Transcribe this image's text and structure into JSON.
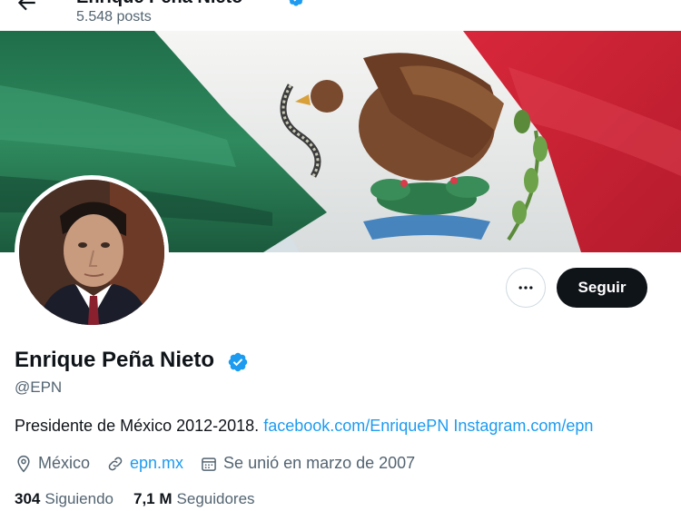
{
  "header": {
    "title": "Enrique Peña Nieto",
    "post_count": "5.548 posts"
  },
  "profile": {
    "display_name": "Enrique Peña Nieto",
    "handle": "@EPN",
    "bio_text": "Presidente de México 2012-2018.",
    "bio_link_1": "facebook.com/EnriquePN",
    "bio_link_2": "Instagram.com/epn",
    "location": "México",
    "website": "epn.mx",
    "joined": "Se unió en marzo de 2007",
    "following_count": "304",
    "following_label": "Siguiendo",
    "followers_count": "7,1 M",
    "followers_label": "Seguidores"
  },
  "actions": {
    "more_label": "···",
    "follow_label": "Seguir"
  },
  "icons": {
    "back": "arrow-left-icon",
    "verified": "verified-badge-icon",
    "location": "location-pin-icon",
    "link": "link-icon",
    "calendar": "calendar-icon"
  },
  "colors": {
    "accent": "#1d9bf0",
    "text_primary": "#0f1419",
    "text_secondary": "#536471",
    "follow_bg": "#0f1419"
  }
}
